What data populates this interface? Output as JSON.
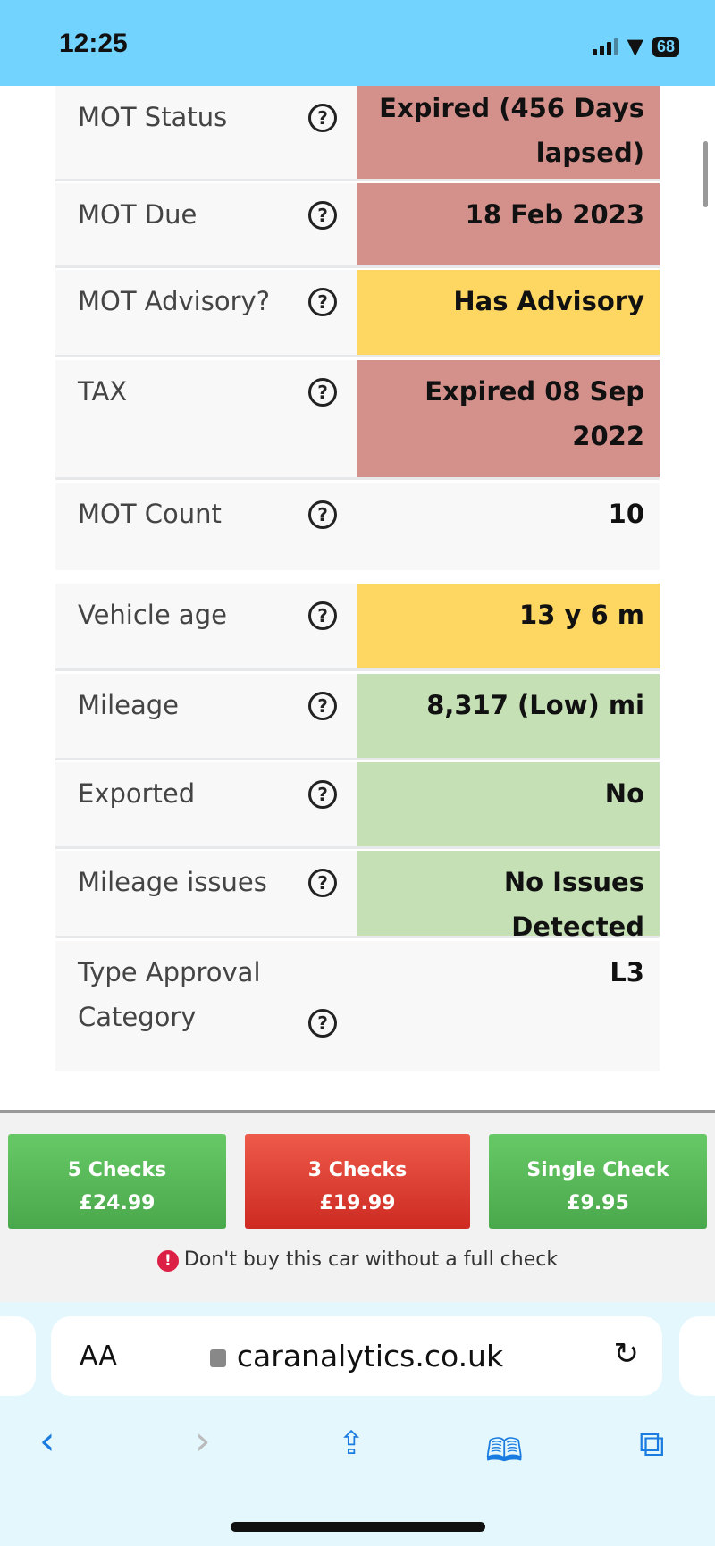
{
  "status_bar": {
    "time": "12:25",
    "battery": "68"
  },
  "rows": [
    {
      "label": "MOT Status",
      "value": "Expired (456 Days lapsed)",
      "status": "red"
    },
    {
      "label": "MOT Due",
      "value": "18 Feb 2023",
      "status": "red"
    },
    {
      "label": "MOT Advisory?",
      "value": "Has Advisory",
      "status": "yellow"
    },
    {
      "label": "TAX",
      "value": "Expired 08 Sep 2022",
      "status": "red"
    },
    {
      "label": "MOT Count",
      "value": "10",
      "status": "neutral"
    },
    {
      "label": "Vehicle age",
      "value": "13 y 6 m",
      "status": "yellow"
    },
    {
      "label": "Mileage",
      "value": "8,317 (Low) mi",
      "status": "green"
    },
    {
      "label": "Exported",
      "value": "No",
      "status": "green"
    },
    {
      "label": "Mileage issues",
      "value": "No Issues Detected",
      "status": "green"
    },
    {
      "label": "Type Approval Category",
      "value": "L3",
      "status": "neutral"
    }
  ],
  "help_icon": "?",
  "offers": [
    {
      "title": "5 Checks",
      "price": "£24.99",
      "color": "#4caf50"
    },
    {
      "title": "3 Checks",
      "price": "£19.99",
      "color": "#e53935"
    },
    {
      "title": "Single Check",
      "price": "£9.95",
      "color": "#4caf50"
    }
  ],
  "warning": "Don't buy this car without a full check",
  "browser": {
    "aa": "AA",
    "url": "caranalytics.co.uk"
  },
  "colors": {
    "red": "#d4918c",
    "yellow": "#fdd762",
    "green": "#c6e0b5",
    "statusbar": "#72d3fe"
  }
}
